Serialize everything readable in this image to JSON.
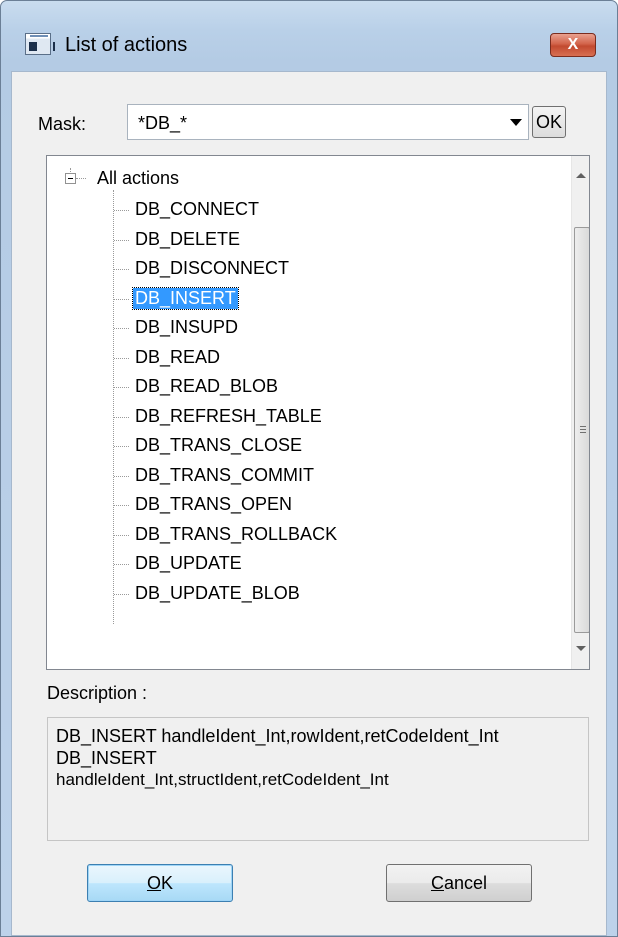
{
  "window": {
    "title": "List of actions",
    "close_glyph": "X",
    "icon": "app-window-icon"
  },
  "mask": {
    "label": "Mask:",
    "value": "*DB_*",
    "ok_label": "OK"
  },
  "tree": {
    "root_label": "All actions",
    "expander": "−",
    "selected_index": 3,
    "items": [
      "DB_CONNECT",
      "DB_DELETE",
      "DB_DISCONNECT",
      "DB_INSERT",
      "DB_INSUPD",
      "DB_READ",
      "DB_READ_BLOB",
      "DB_REFRESH_TABLE",
      "DB_TRANS_CLOSE",
      "DB_TRANS_COMMIT",
      "DB_TRANS_OPEN",
      "DB_TRANS_ROLLBACK",
      "DB_UPDATE",
      "DB_UPDATE_BLOB"
    ]
  },
  "description": {
    "label": "Description :",
    "lines": [
      "DB_INSERT handleIdent_Int,rowIdent,retCodeIdent_Int",
      "DB_INSERT",
      "handleIdent_Int,structIdent,retCodeIdent_Int"
    ]
  },
  "buttons": {
    "ok_mnemonic": "O",
    "ok_rest": "K",
    "cancel_mnemonic": "C",
    "cancel_rest": "ancel"
  },
  "colors": {
    "selection": "#3399ff",
    "title_bar": "#b9d0e8",
    "close_button": "#c24a30",
    "dialog_face": "#f0f0f0"
  }
}
